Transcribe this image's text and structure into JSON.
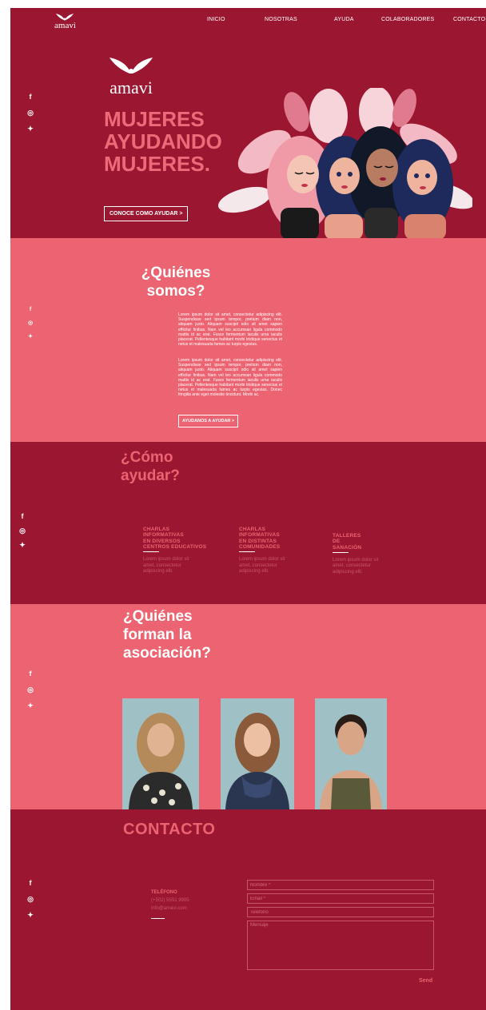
{
  "brand": {
    "name": "amavi"
  },
  "nav": {
    "items": [
      "INICIO",
      "NOSOTRAS",
      "AYUDA",
      "COLABORADORES",
      "CONTACTO"
    ]
  },
  "social": [
    "facebook-icon",
    "instagram-icon",
    "twitter-icon"
  ],
  "hero": {
    "title_lines": [
      "MUJERES",
      "AYUDANDO",
      "MUJERES."
    ],
    "cta": "CONOCE COMO AYUDAR >"
  },
  "about": {
    "title_lines": [
      "¿Quiénes",
      "somos?"
    ],
    "paragraph1": "Lorem ipsum dolor sit amet, consectetur adipiscing elit. Suspendisse sed ipsum tempor, pretium diam non, aliquam justo. Aliquam suscipit odio sit amet sapien efficitur finibus. Nam vel leo accumsan ligula commodo mattis id ac erat. Fusce fermentum iaculis urna iaculis placerat. Pellentesque habitant morbi tristique senectus et netus et malesuada fames ac turpis egestas.",
    "paragraph2": "Lorem ipsum dolor sit amet, consectetur adipiscing elit. Suspendisse sed ipsum tempor, pretium diam non, aliquam justo. Aliquam suscipit odio sit amet sapien efficitur finibus. Nam vel leo accumsan ligula commodo mattis id ac erat. Fusce fermentum iaculis urna iaculis placerat. Pellentesque habitant morbi tristique senectus et netus et malesuada fames ac turpis egestas. Donec fringilla ante eget molestie tincidunt. Morbi ac.",
    "cta": "AYUDANOS A AYUDAR >"
  },
  "help": {
    "title_lines": [
      "¿Cómo",
      "ayudar?"
    ],
    "columns": [
      {
        "title_lines": [
          "CHARLAS",
          "INFORMATIVAS",
          "EN DIVERSOS",
          "CENTROS EDUCATIVOS"
        ],
        "text_lines": [
          "Lorem ipsum dolor sit",
          "amet, consectetur",
          "adipiscing elit."
        ]
      },
      {
        "title_lines": [
          "CHARLAS",
          "INFORMATIVAS",
          "EN DISTINTAS",
          "COMUNIDADES"
        ],
        "text_lines": [
          "Lorem ipsum dolor sit",
          "amet, consectetur",
          "adipiscing elit."
        ]
      },
      {
        "title_lines": [
          "TALLERES",
          "DE",
          "SANACIÓN"
        ],
        "text_lines": [
          "Lorem ipsum dolor sit",
          "amet, consectetur",
          "adipiscing elit."
        ]
      }
    ]
  },
  "team": {
    "title_lines": [
      "¿Quiénes",
      "forman la",
      "asociación?"
    ]
  },
  "contact": {
    "title": "CONTACTO",
    "phone_label": "TELÉFONO",
    "phone": "(+502) 5551 9995",
    "email": "info@amavi.com",
    "form": {
      "name_placeholder": "Nombre *",
      "email_placeholder": "Email *",
      "phone_placeholder": "Teléfono",
      "message_placeholder": "Mensaje",
      "send_label": "Send"
    }
  },
  "colors": {
    "dark": "#9b1630",
    "pink": "#ec6471",
    "accent": "#ee6a78"
  }
}
